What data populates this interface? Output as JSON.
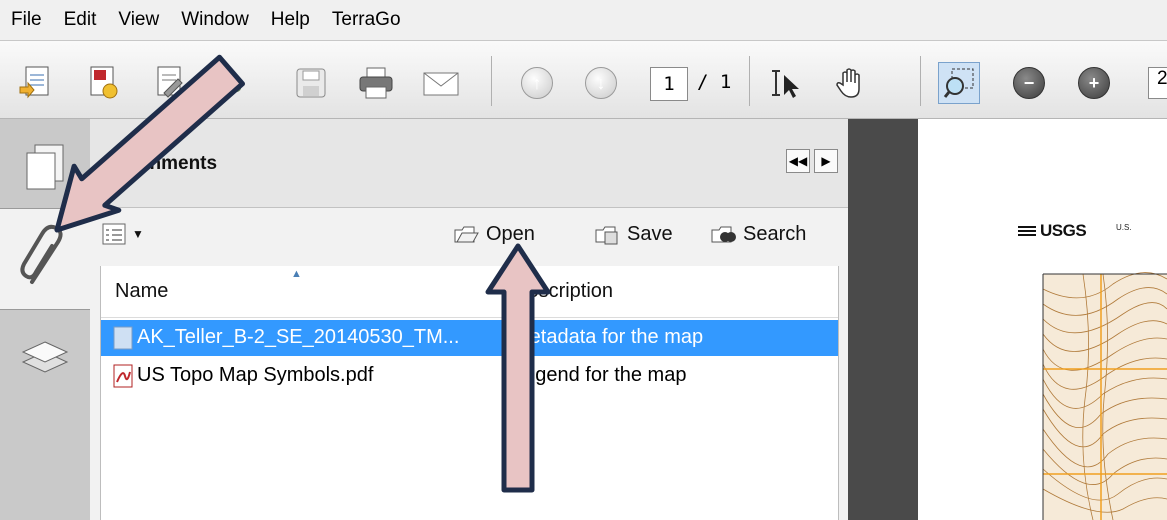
{
  "menu": [
    "File",
    "Edit",
    "View",
    "Window",
    "Help",
    "TerraGo"
  ],
  "toolbar": {
    "icons": [
      "create-icon",
      "export-icon",
      "edit-icon",
      "upload-icon",
      "save-icon",
      "print-icon",
      "email-icon",
      "prev-page-icon",
      "next-page-icon",
      "select-icon",
      "hand-icon",
      "marquee-zoom-icon",
      "zoom-out-icon",
      "zoom-in-icon"
    ],
    "page_current": "1",
    "page_total": "/ 1",
    "zoom": "2"
  },
  "panel": {
    "title": "Attachments",
    "tools": {
      "open": "Open",
      "save": "Save",
      "search": "Search"
    },
    "columns": [
      "Name",
      "Description"
    ],
    "rows": [
      {
        "name": "AK_Teller_B-2_SE_20140530_TM...",
        "description": "Metadata for the map",
        "selected": true
      },
      {
        "name": "US Topo Map Symbols.pdf",
        "description": "Legend for the map",
        "selected": false
      }
    ]
  },
  "map": {
    "logo": "USGS",
    "header": "U.S."
  },
  "colors": {
    "selection": "#3399ff",
    "arrow_fill": "#e8c4c4",
    "arrow_stroke": "#1f2d4a",
    "map_contour": "#b07a3a",
    "map_grid": "#f0a020"
  }
}
